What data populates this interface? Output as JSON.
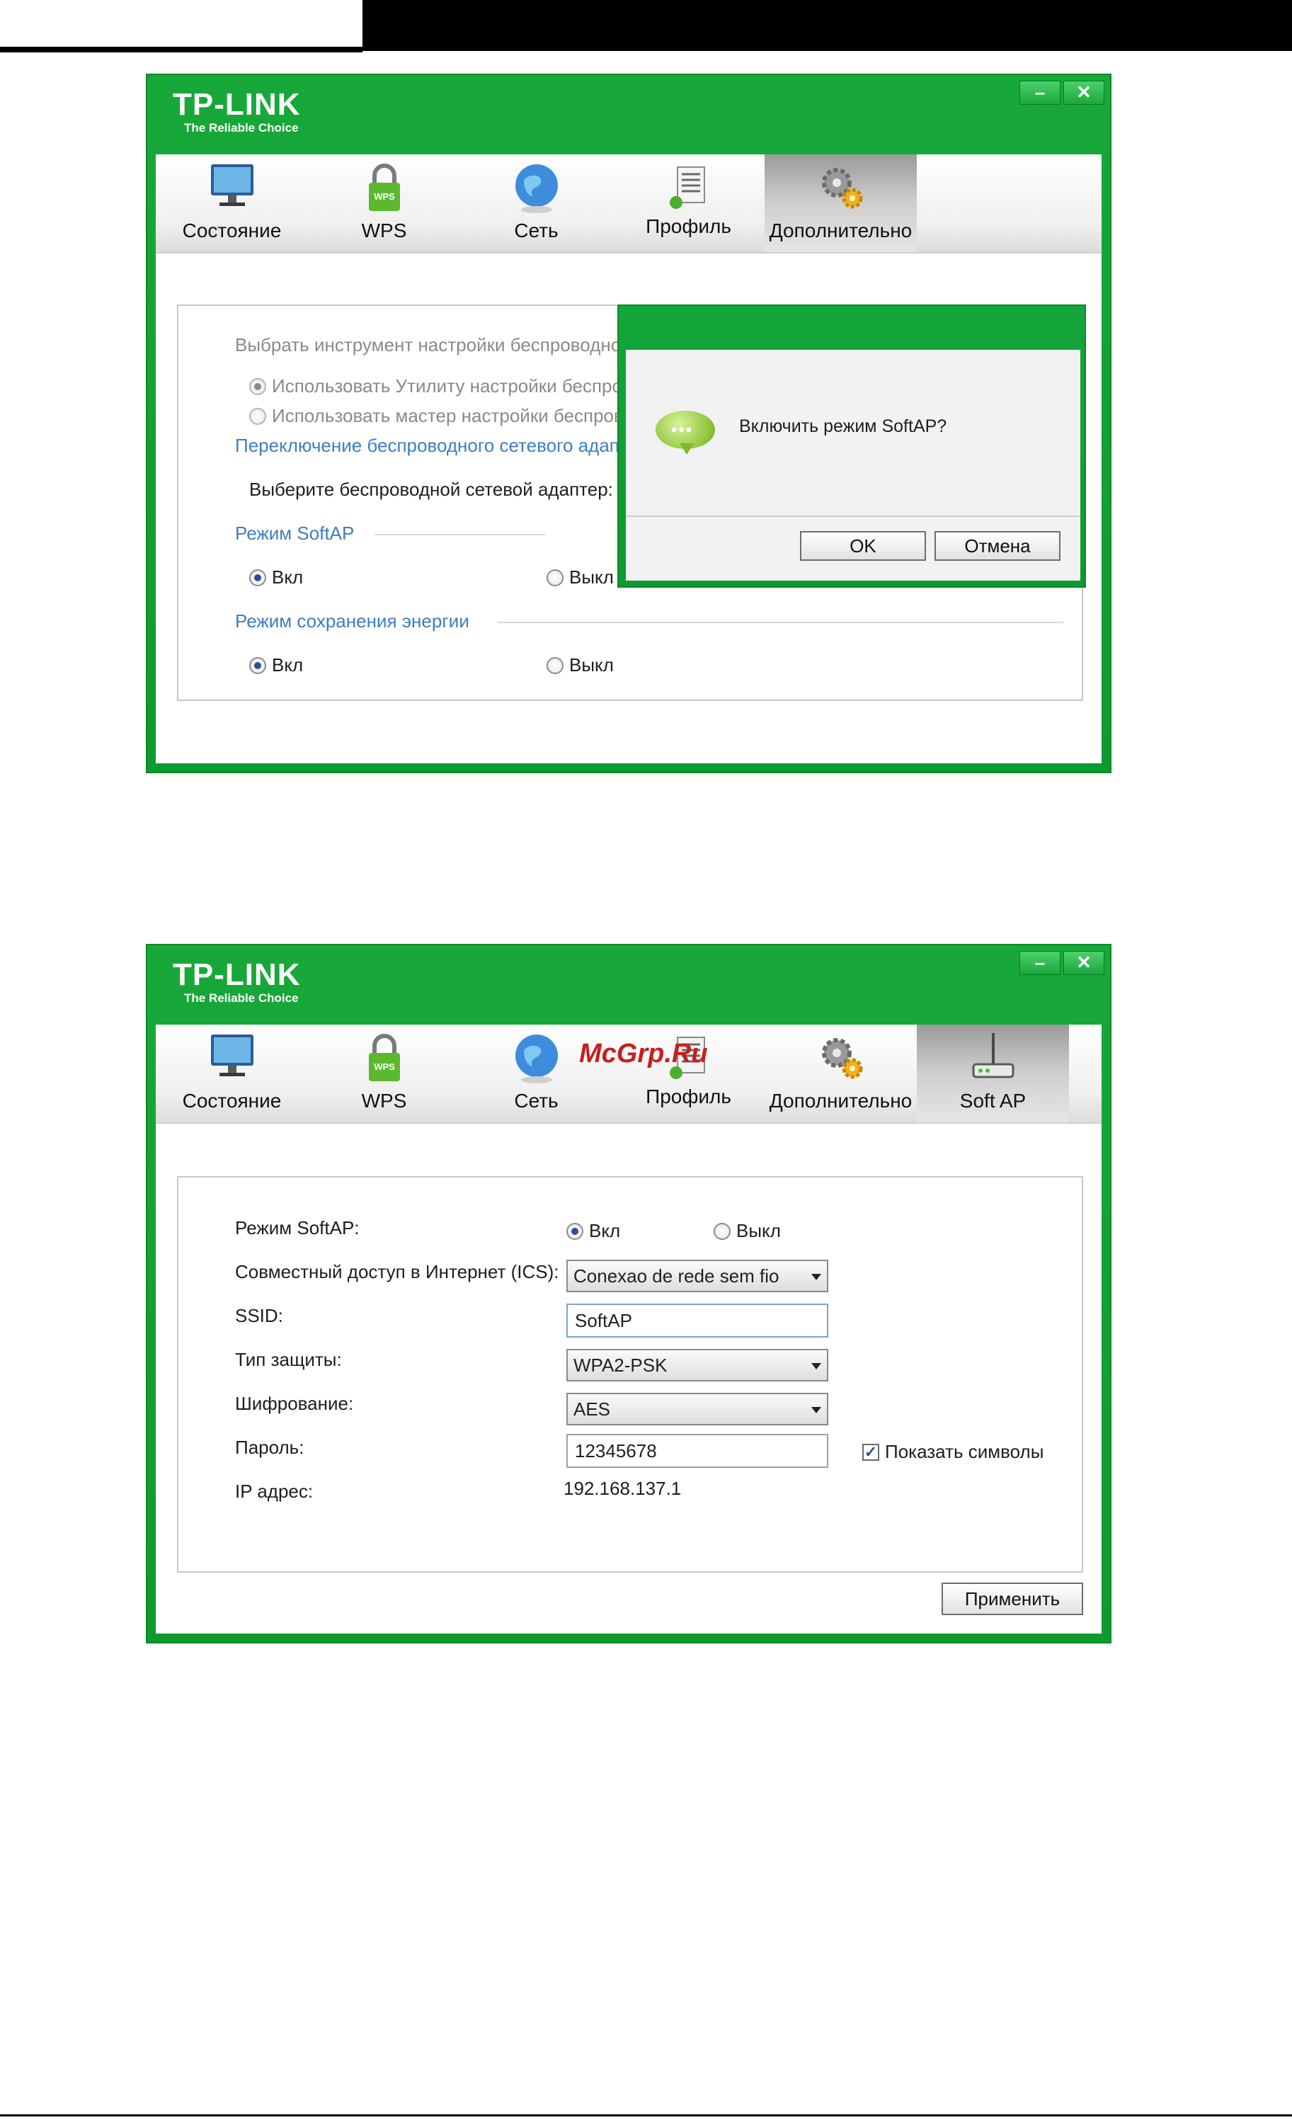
{
  "logo": {
    "main": "TP-LINK",
    "sub": "The Reliable Choice"
  },
  "window_buttons": {
    "minimize": "–",
    "close": "✕"
  },
  "tabs1": [
    {
      "label": "Состояние",
      "icon": "monitor-icon"
    },
    {
      "label": "WPS",
      "icon": "wps-lock-icon"
    },
    {
      "label": "Сеть",
      "icon": "globe-icon"
    },
    {
      "label": "Профиль",
      "icon": "profile-doc-icon"
    },
    {
      "label": "Дополнительно",
      "icon": "gears-icon"
    }
  ],
  "tabs2": [
    {
      "label": "Состояние",
      "icon": "monitor-icon"
    },
    {
      "label": "WPS",
      "icon": "wps-lock-icon"
    },
    {
      "label": "Сеть",
      "icon": "globe-icon"
    },
    {
      "label": "Профиль",
      "icon": "profile-doc-icon"
    },
    {
      "label": "Дополнительно",
      "icon": "gears-icon"
    },
    {
      "label": "Soft AP",
      "icon": "router-icon"
    }
  ],
  "advanced": {
    "tool_heading": "Выбрать инструмент настройки беспроводно",
    "opt_utility": "Использовать Утилиту настройки беспров",
    "opt_wizard": "Использовать мастер настройки беспрово",
    "adapter_switch_heading": "Переключение беспроводного сетевого адап",
    "select_adapter": "Выберите беспроводной сетевой адаптер:",
    "softap_heading": "Режим SoftAP",
    "softap_on": "Вкл",
    "softap_off": "Выкл",
    "power_heading": "Режим сохранения энергии",
    "power_on": "Вкл",
    "power_off": "Выкл"
  },
  "dialog": {
    "message": "Включить режим SoftAP?",
    "bubble": "•••",
    "ok": "OK",
    "cancel": "Отмена"
  },
  "softap": {
    "mode_label": "Режим SoftAP:",
    "mode_on": "Вкл",
    "mode_off": "Выкл",
    "mode_selected": "Вкл",
    "ics_label": "Совместный доступ в Интернет (ICS):",
    "ics_value": "Conexao de rede sem fio",
    "ssid_label": "SSID:",
    "ssid_value": "SoftAP",
    "security_label": "Тип защиты:",
    "security_value": "WPA2-PSK",
    "encryption_label": "Шифрование:",
    "encryption_value": "AES",
    "password_label": "Пароль:",
    "password_value": "12345678",
    "show_chars_label": "Показать символы",
    "show_chars_checked": true,
    "ip_label": "IP адрес:",
    "ip_value": "192.168.137.1",
    "apply": "Применить"
  },
  "watermark": "McGrp.Ru"
}
